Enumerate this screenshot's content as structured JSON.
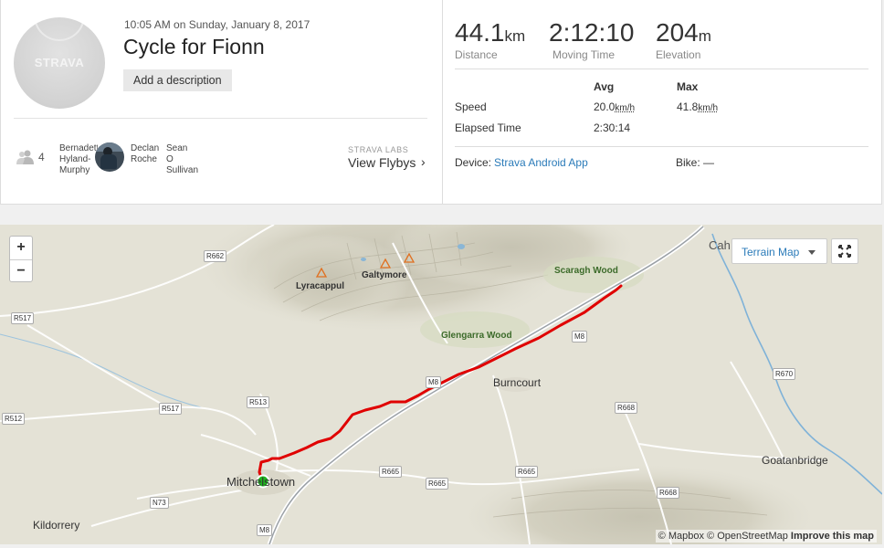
{
  "activity": {
    "avatar_logo": "STRAVA",
    "date_line": "10:05 AM on Sunday, January 8, 2017",
    "title": "Cycle for Fionn",
    "add_description": "Add a description"
  },
  "athletes": {
    "count": "4",
    "first": [
      "Bernadette",
      "Hyland-",
      "Murphy"
    ],
    "second": [
      "Declan",
      "Roche"
    ],
    "third": [
      "Sean",
      "O",
      "Sullivan"
    ]
  },
  "flybys": {
    "caption": "STRAVA LABS",
    "label": "View Flybys",
    "chevron": "›"
  },
  "stats": {
    "distance": {
      "value": "44.1",
      "unit": "km",
      "label": "Distance"
    },
    "moving_time": {
      "value": "2:12:10",
      "label": "Moving Time"
    },
    "elevation": {
      "value": "204",
      "unit": "m",
      "label": "Elevation"
    },
    "headers": {
      "avg": "Avg",
      "max": "Max"
    },
    "speed": {
      "label": "Speed",
      "avg": "20.0",
      "max": "41.8",
      "unit": "km/h"
    },
    "elapsed": {
      "label": "Elapsed Time",
      "avg": "2:30:14"
    },
    "device_label": "Device:",
    "device_value": "Strava Android App",
    "bike": "Bike: —"
  },
  "map": {
    "zoom_in": "+",
    "zoom_out": "−",
    "style_label": "Terrain Map",
    "places": {
      "cah": "Cah",
      "scaragh": "Scaragh Wood",
      "lyracappul": "Lyracappul",
      "galtymore": "Galtymore",
      "glengarra": "Glengarra Wood",
      "burncourt": "Burncourt",
      "mitchelstown": "Mitchelstown",
      "goatanbridge": "Goatanbridge",
      "kildorrery": "Kildorrery"
    },
    "roads": {
      "r662": "R662",
      "r517a": "R517",
      "r517b": "R517",
      "r512": "R512",
      "r513": "R513",
      "n73": "N73",
      "m8a": "M8",
      "m8b": "M8",
      "m8c": "M8",
      "r665a": "R665",
      "r665b": "R665",
      "r665c": "R665",
      "r668a": "R668",
      "r668b": "R668",
      "r670": "R670"
    },
    "attribution": {
      "mapbox": "© Mapbox",
      "osm": "© OpenStreetMap",
      "improve": "Improve this map"
    },
    "route_color": "#e00000",
    "start_color": "#1fb31f"
  }
}
